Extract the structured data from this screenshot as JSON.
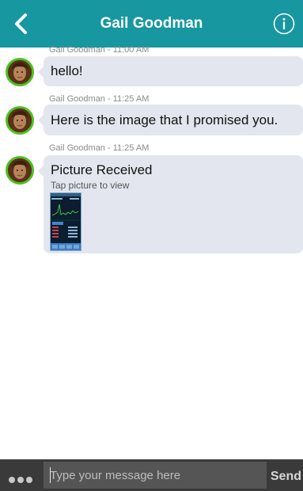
{
  "header": {
    "title": "Gail Goodman",
    "back_icon": "chevron-left-icon",
    "info_icon": "info-icon",
    "color": "#1797a0"
  },
  "messages": [
    {
      "meta": "Gail Goodman - 11:00 AM",
      "text": "hello!"
    },
    {
      "meta": "Gail Goodman - 11:25 AM",
      "text": "Here is the image that I promised you."
    },
    {
      "meta": "Gail Goodman - 11:25 AM",
      "text": "Picture Received",
      "subtext": "Tap picture to view",
      "has_image": true
    }
  ],
  "composer": {
    "more_icon": "ellipsis-icon",
    "placeholder": "Type your message here",
    "send_label": "Send"
  },
  "colors": {
    "avatar_ring": "#4ec021",
    "bubble": "#e3e6ee",
    "footer": "#3a3a3a"
  }
}
